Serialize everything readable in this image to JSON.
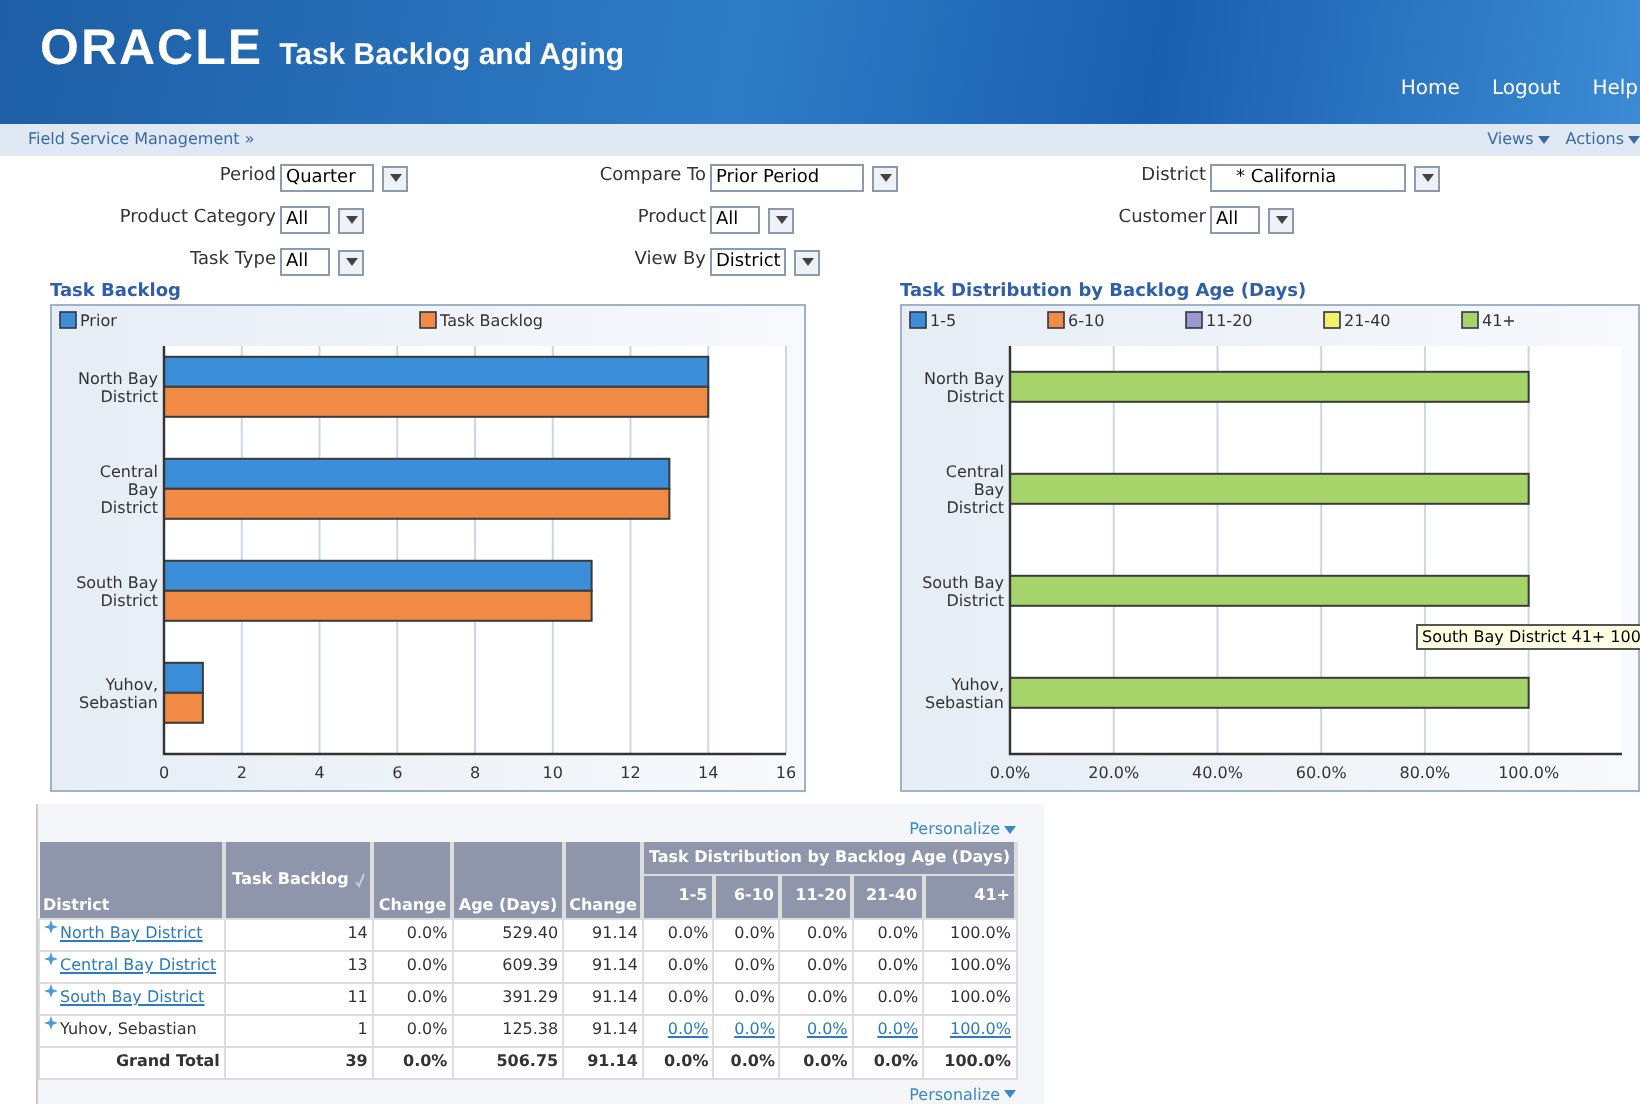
{
  "header": {
    "logo": "ORACLE",
    "title": "Task Backlog and Aging",
    "nav": [
      "Home",
      "Logout",
      "Help"
    ]
  },
  "breadcrumb": "Field Service Management »",
  "page_menus": [
    "Views",
    "Actions"
  ],
  "filters": [
    {
      "label": "Period",
      "value": "Quarter"
    },
    {
      "label": "Compare To",
      "value": "Prior Period"
    },
    {
      "label": "District",
      "value": "* California"
    },
    {
      "label": "Product Category",
      "value": "All"
    },
    {
      "label": "Product",
      "value": "All"
    },
    {
      "label": "Customer",
      "value": "All"
    },
    {
      "label": "Task Type",
      "value": "All"
    },
    {
      "label": "View By",
      "value": "District"
    }
  ],
  "backlog_chart": {
    "chart_data": {
      "type": "bar",
      "orientation": "horizontal",
      "title": "Task Backlog",
      "categories": [
        "North Bay District",
        "Central Bay District",
        "South Bay District",
        "Yuhov, Sebastian"
      ],
      "series": [
        {
          "name": "Prior",
          "color": "#3b8fd9",
          "values": [
            14,
            13,
            11,
            1
          ]
        },
        {
          "name": "Task Backlog",
          "color": "#f08a45",
          "values": [
            14,
            13,
            11,
            1
          ]
        }
      ],
      "xlim": [
        0,
        16
      ],
      "xticks": [
        0,
        2,
        4,
        6,
        8,
        10,
        12,
        14,
        16
      ],
      "grid": true,
      "legend": true
    }
  },
  "distribution_chart": {
    "chart_data": {
      "type": "bar",
      "orientation": "horizontal",
      "stacked": true,
      "title": "Task Distribution by Backlog Age (Days)",
      "categories": [
        "North Bay District",
        "Central Bay District",
        "South Bay District",
        "Yuhov, Sebastian"
      ],
      "series": [
        {
          "name": "1-5",
          "color": "#3b8fd9",
          "values": [
            0,
            0,
            0,
            0
          ]
        },
        {
          "name": "6-10",
          "color": "#f08a45",
          "values": [
            0,
            0,
            0,
            0
          ]
        },
        {
          "name": "11-20",
          "color": "#9a9ad0",
          "values": [
            0,
            0,
            0,
            0
          ]
        },
        {
          "name": "21-40",
          "color": "#f2ef6a",
          "values": [
            0,
            0,
            0,
            0
          ]
        },
        {
          "name": "41+",
          "color": "#a6d46a",
          "values": [
            100,
            100,
            100,
            100
          ]
        }
      ],
      "xlim": [
        0,
        118
      ],
      "grid": true,
      "legend": true,
      "xticks": [
        {
          "value": 0,
          "label": "0.0%"
        },
        {
          "value": 20,
          "label": "20.0%"
        },
        {
          "value": 40,
          "label": "40.0%"
        },
        {
          "value": 60,
          "label": "60.0%"
        },
        {
          "value": 80,
          "label": "80.0%"
        },
        {
          "value": 100,
          "label": "100.0%"
        }
      ],
      "annotations": [
        "South Bay District  41+  100"
      ]
    }
  },
  "table": {
    "personalize": [
      "Personalize",
      "Personalize"
    ],
    "group_heading": "Task Distribution by Backlog Age (Days)",
    "columns": [
      "District",
      "Task Backlog",
      "Change",
      "Age (Days)",
      "Change",
      "1-5",
      "6-10",
      "11-20",
      "21-40",
      "41+"
    ],
    "rows": [
      {
        "kind": "district_link",
        "district": "North Bay District",
        "values": [
          "14",
          "0.0%",
          "529.40",
          "91.14",
          "0.0%",
          "0.0%",
          "0.0%",
          "0.0%",
          "100.0%"
        ]
      },
      {
        "kind": "district_link",
        "district": "Central Bay District",
        "values": [
          "13",
          "0.0%",
          "609.39",
          "91.14",
          "0.0%",
          "0.0%",
          "0.0%",
          "0.0%",
          "100.0%"
        ]
      },
      {
        "kind": "district_link",
        "district": "South Bay District",
        "values": [
          "11",
          "0.0%",
          "391.29",
          "91.14",
          "0.0%",
          "0.0%",
          "0.0%",
          "0.0%",
          "100.0%"
        ]
      },
      {
        "kind": "value_links",
        "district": "Yuhov, Sebastian",
        "values": [
          "1",
          "0.0%",
          "125.38",
          "91.14",
          "0.0%",
          "0.0%",
          "0.0%",
          "0.0%",
          "100.0%"
        ]
      },
      {
        "kind": "total",
        "district": "Grand Total",
        "values": [
          "39",
          "0.0%",
          "506.75",
          "91.14",
          "0.0%",
          "0.0%",
          "0.0%",
          "0.0%",
          "100.0%"
        ]
      }
    ]
  }
}
